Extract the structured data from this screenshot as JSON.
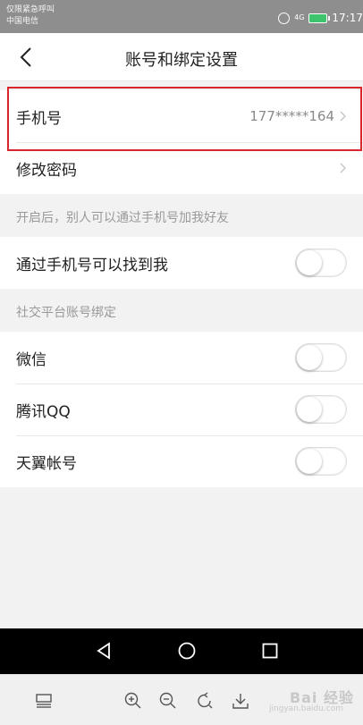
{
  "status_bar": {
    "line1": "仅限紧急呼叫",
    "line2": "中国电信",
    "signal": "4G",
    "time": "17:17",
    "battery_color": "#3ec46d"
  },
  "navbar": {
    "back_icon": "chevron-left-icon",
    "title": "账号和绑定设置"
  },
  "account_group": {
    "phone": {
      "label": "手机号",
      "value": "177*****164"
    },
    "password": {
      "label": "修改密码"
    }
  },
  "hint_section": {
    "label": "开启后，别人可以通过手机号加我好友"
  },
  "find_by_phone": {
    "label": "通过手机号可以找到我",
    "enabled": false
  },
  "social_section": {
    "label": "社交平台账号绑定"
  },
  "social_items": [
    {
      "label": "微信",
      "enabled": false
    },
    {
      "label": "腾讯QQ",
      "enabled": false
    },
    {
      "label": "天翼帐号",
      "enabled": false
    }
  ],
  "system_nav": {
    "back_icon": "triangle-back-icon",
    "home_icon": "circle-home-icon",
    "recent_icon": "square-recent-icon"
  },
  "bottom_toolbar": {
    "icons": [
      "layout-icon",
      "zoom-in-icon",
      "zoom-out-icon",
      "rotate-icon",
      "download-icon"
    ],
    "watermark": "Bai 经验",
    "watermark_sub": "jingyan.baidu.com"
  },
  "colors": {
    "highlight": "#d9262c",
    "accent_status": "#8e8e8e"
  }
}
